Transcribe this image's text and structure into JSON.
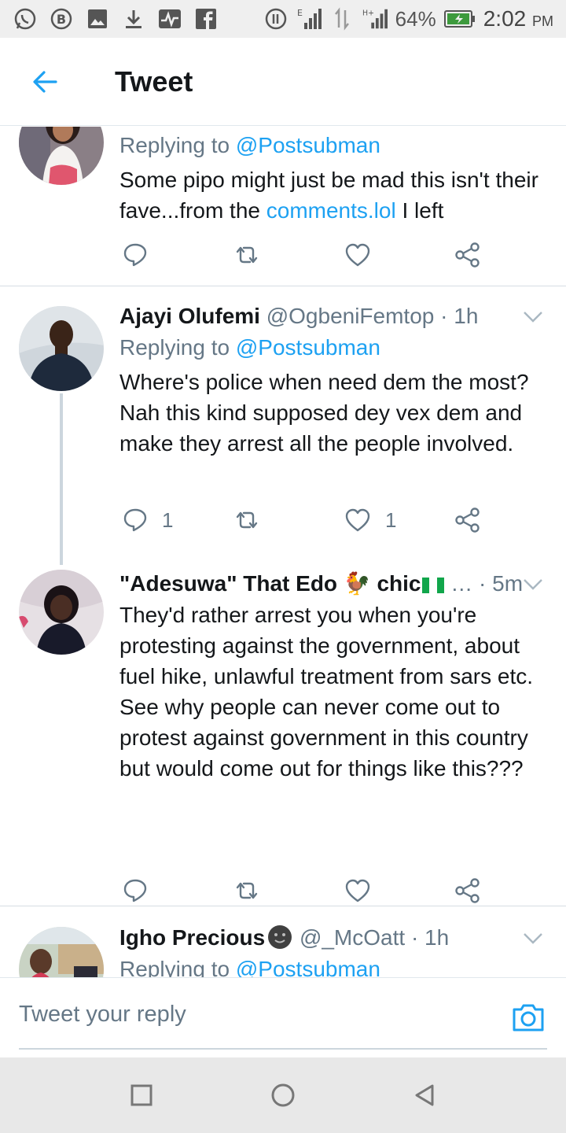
{
  "status_bar": {
    "battery": "64%",
    "time": "2:02",
    "ampm": "PM"
  },
  "header": {
    "title": "Tweet"
  },
  "tweets": [
    {
      "reply_prefix": "Replying to ",
      "reply_handle": "@Postsubman",
      "text_before": "Some pipo might just be mad this isn't their fave...from the ",
      "text_link": "comments.lol",
      "text_after": " I left",
      "reply_count": "",
      "like_count": ""
    },
    {
      "name": "Ajayi Olufemi",
      "handle": "@OgbeniFemtop",
      "time": "· 1h",
      "reply_prefix": "Replying to ",
      "reply_handle": "@Postsubman",
      "text": "Where's police when need dem the most? Nah this kind supposed dey vex dem and make they arrest all the people involved.",
      "reply_count": "1",
      "like_count": "1"
    },
    {
      "name": "\"Adesuwa\" That Edo 🐓 chic",
      "handle": "…",
      "time": "· 5m",
      "text": "They'd rather arrest you when you're protesting against the government, about fuel hike, unlawful treatment from sars etc.\nSee why people can never come out to protest against government in this country but would come out for things like this???",
      "reply_count": "",
      "like_count": ""
    },
    {
      "name": "Igho Precious",
      "handle": "@_McOatt",
      "time": "· 1h",
      "reply_prefix": "Replying to ",
      "reply_handle": "@Postsubman"
    }
  ],
  "reply_bar": {
    "placeholder": "Tweet your reply"
  },
  "colors": {
    "accent": "#1da1f2",
    "secondary_text": "#657786",
    "primary_text": "#14171a"
  }
}
